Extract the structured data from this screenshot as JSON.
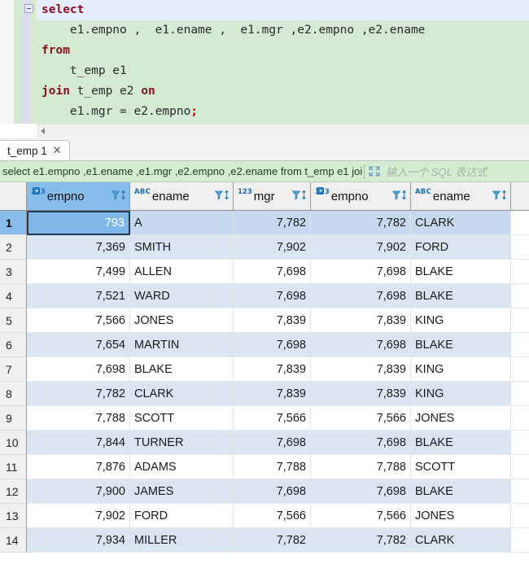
{
  "editor": {
    "fold_icon": "fold-collapse-icon",
    "lines": [
      {
        "indent": 0,
        "tokens": [
          {
            "t": "kw",
            "v": "select"
          }
        ]
      },
      {
        "indent": 1,
        "tokens": [
          {
            "t": "ident",
            "v": "e1.empno ,  e1.ename ,  e1.mgr ,e2.empno ,e2.ename"
          }
        ]
      },
      {
        "indent": 0,
        "tokens": [
          {
            "t": "kw",
            "v": "from"
          }
        ]
      },
      {
        "indent": 1,
        "tokens": [
          {
            "t": "ident",
            "v": "t_emp e1"
          }
        ]
      },
      {
        "indent": 0,
        "tokens": [
          {
            "t": "kw",
            "v": "join"
          },
          {
            "t": "ident",
            "v": " t_emp e2 "
          },
          {
            "t": "kw",
            "v": "on"
          }
        ]
      },
      {
        "indent": 1,
        "tokens": [
          {
            "t": "ident",
            "v": "e1.mgr = e2.empno"
          },
          {
            "t": "semi",
            "v": ";"
          }
        ]
      }
    ],
    "current_line_index": 0,
    "full_text": "select\n    e1.empno ,  e1.ename ,  e1.mgr ,e2.empno ,e2.ename\nfrom\n    t_emp e1\njoin t_emp e2 on\n    e1.mgr = e2.empno;",
    "colors": {
      "background": "#d5ead3",
      "keyword": "#8b0f1e",
      "current_line": "#e9eeff",
      "semicolon": "#cc0000"
    }
  },
  "tabs": [
    {
      "label": "t_emp 1",
      "close_label": "✕",
      "active": true
    }
  ],
  "filter_bar": {
    "sql_text": "select e1.empno ,e1.ename ,e1.mgr ,e2.empno ,e2.ename from t_emp e1 joi",
    "expand_icon": "expand-arrows-icon",
    "placeholder": "输入一个 SQL 表达式",
    "background": "#d6ecd2"
  },
  "grid": {
    "columns": [
      {
        "label": "empno",
        "type_icon": "123",
        "is_key": true,
        "align": "num",
        "selected": true
      },
      {
        "label": "ename",
        "type_icon": "ABC",
        "is_key": false,
        "align": "txt",
        "selected": false
      },
      {
        "label": "mgr",
        "type_icon": "123",
        "is_key": false,
        "align": "num",
        "selected": false
      },
      {
        "label": "empno",
        "type_icon": "123",
        "is_key": true,
        "align": "num",
        "selected": false
      },
      {
        "label": "ename",
        "type_icon": "ABC",
        "is_key": false,
        "align": "txt",
        "selected": false
      }
    ],
    "header_icons": {
      "filter": "filter-funnel-icon",
      "sort": "sort-updown-icon"
    },
    "selected_row": 1,
    "active_cell": {
      "row": 1,
      "col": 0,
      "value": "793"
    },
    "rows": [
      {
        "n": "1",
        "cells": [
          "793",
          "A",
          "7,782",
          "7,782",
          "CLARK"
        ]
      },
      {
        "n": "2",
        "cells": [
          "7,369",
          "SMITH",
          "7,902",
          "7,902",
          "FORD"
        ]
      },
      {
        "n": "3",
        "cells": [
          "7,499",
          "ALLEN",
          "7,698",
          "7,698",
          "BLAKE"
        ]
      },
      {
        "n": "4",
        "cells": [
          "7,521",
          "WARD",
          "7,698",
          "7,698",
          "BLAKE"
        ]
      },
      {
        "n": "5",
        "cells": [
          "7,566",
          "JONES",
          "7,839",
          "7,839",
          "KING"
        ]
      },
      {
        "n": "6",
        "cells": [
          "7,654",
          "MARTIN",
          "7,698",
          "7,698",
          "BLAKE"
        ]
      },
      {
        "n": "7",
        "cells": [
          "7,698",
          "BLAKE",
          "7,839",
          "7,839",
          "KING"
        ]
      },
      {
        "n": "8",
        "cells": [
          "7,782",
          "CLARK",
          "7,839",
          "7,839",
          "KING"
        ]
      },
      {
        "n": "9",
        "cells": [
          "7,788",
          "SCOTT",
          "7,566",
          "7,566",
          "JONES"
        ]
      },
      {
        "n": "10",
        "cells": [
          "7,844",
          "TURNER",
          "7,698",
          "7,698",
          "BLAKE"
        ]
      },
      {
        "n": "11",
        "cells": [
          "7,876",
          "ADAMS",
          "7,788",
          "7,788",
          "SCOTT"
        ]
      },
      {
        "n": "12",
        "cells": [
          "7,900",
          "JAMES",
          "7,698",
          "7,698",
          "BLAKE"
        ]
      },
      {
        "n": "13",
        "cells": [
          "7,902",
          "FORD",
          "7,566",
          "7,566",
          "JONES"
        ]
      },
      {
        "n": "14",
        "cells": [
          "7,934",
          "MILLER",
          "7,782",
          "7,782",
          "CLARK"
        ]
      }
    ]
  }
}
